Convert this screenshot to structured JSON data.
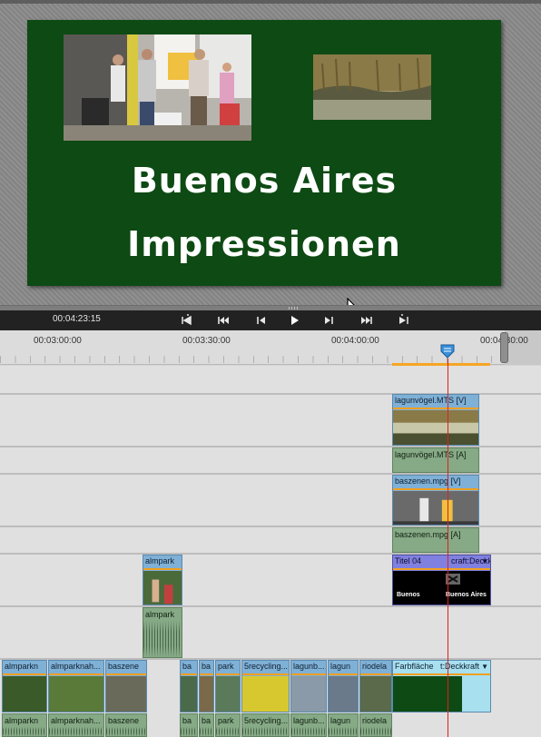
{
  "monitor": {
    "title_line1": "Buenos Aires",
    "title_line2": "Impressionen"
  },
  "transport": {
    "timecode": "00:04:23:15",
    "buttons": [
      {
        "name": "goto-in-point-button",
        "glyph": "⇤"
      },
      {
        "name": "goto-previous-edit-button",
        "glyph": "⏮"
      },
      {
        "name": "step-back-button",
        "glyph": "◀"
      },
      {
        "name": "play-button",
        "glyph": "▶"
      },
      {
        "name": "step-forward-button",
        "glyph": "▶"
      },
      {
        "name": "goto-next-edit-button",
        "glyph": "⏭"
      },
      {
        "name": "goto-out-point-button",
        "glyph": "⇥"
      }
    ]
  },
  "ruler": {
    "labels": [
      "00:03:00:00",
      "00:03:30:00",
      "00:04:00:00",
      "00:04:30:00"
    ]
  },
  "tracks": {
    "v3_clip": "lagunvögel.MTS [V]",
    "a3_clip": "lagunvögel.MTS [A]",
    "v2_clip": "baszenen.mpg [V]",
    "a2_clip": "baszenen.mpg [A]",
    "v1_clip_almpark": "almpark",
    "a1_clip_almpark": "almpark",
    "title_clip": "Titel 04",
    "title_clip_effect": "craft:Deckkraft",
    "title_clip_thumb_text1": "Buenos",
    "title_clip_thumb_text2": "Buenos Aires",
    "video_clips": [
      "almparkn",
      "almparknah...",
      "baszene",
      "ba",
      "ba",
      "park",
      "5recycling...",
      "lagunb...",
      "lagun",
      "riodela"
    ],
    "audio_clips": [
      "almparkn",
      "almparknah...",
      "baszene",
      "ba",
      "ba",
      "park",
      "5recycling...",
      "lagunb...",
      "lagun",
      "riodela"
    ],
    "color_matte_clip": "Farbfläche",
    "color_matte_effect": "t:Deckkraft"
  },
  "colors": {
    "title_bg": "#0e4a14",
    "video_clip": "#7fb0d6",
    "audio_clip": "#86a986",
    "title_clip": "#8080e0",
    "playhead": "#e02020",
    "work_area": "#f5a623"
  }
}
